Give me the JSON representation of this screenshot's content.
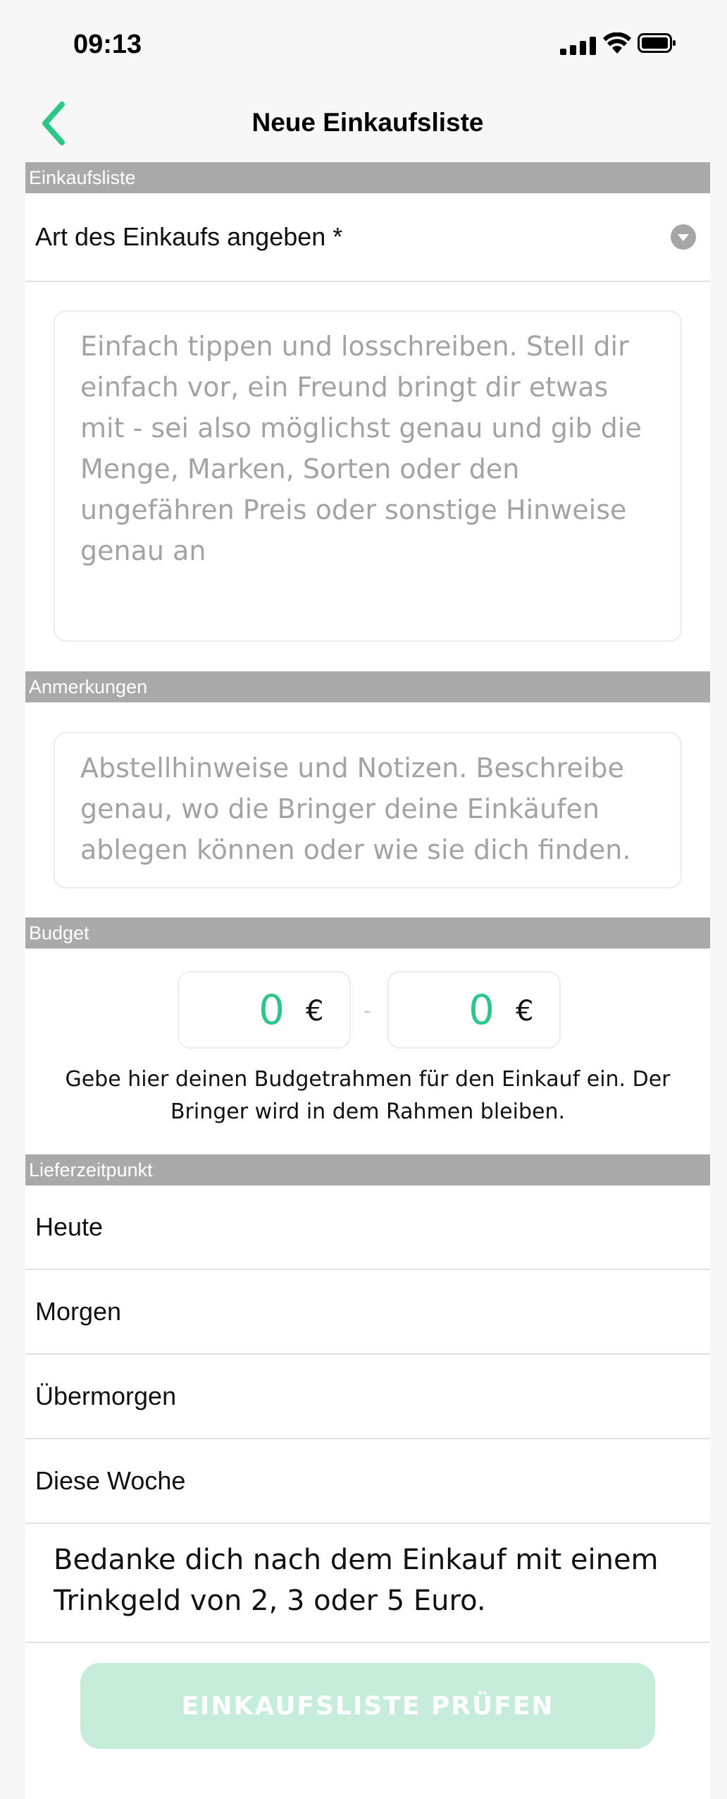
{
  "status_bar": {
    "time": "09:13"
  },
  "nav": {
    "title": "Neue Einkaufsliste",
    "back_icon": "chevron-left-icon"
  },
  "colors": {
    "accent": "#2bc789",
    "section_header": "#a9a9a9",
    "button_disabled": "#c5edd9"
  },
  "sections": {
    "einkaufsliste": "Einkaufsliste",
    "anmerkungen": "Anmerkungen",
    "budget": "Budget",
    "lieferzeitpunkt": "Lieferzeitpunkt"
  },
  "shopping_type": {
    "label": "Art des Einkaufs angeben *",
    "icon": "chevron-down-circle-icon"
  },
  "list_field": {
    "placeholder": "Einfach tippen und losschreiben. Stell dir einfach vor, ein Freund bringt dir etwas mit - sei also möglichst genau und gib die Menge, Marken, Sorten oder den ungefähren Preis oder sonstige Hinweise genau an"
  },
  "notes_field": {
    "placeholder": "Abstellhinweise und Notizen. Beschreibe genau, wo die Bringer deine Einkäufen ablegen können oder wie sie dich finden."
  },
  "budget": {
    "min": "0",
    "max": "0",
    "currency": "€",
    "separator": "-",
    "hint": "Gebe hier deinen Budgetrahmen für den Einkauf ein. Der Bringer wird in dem Rahmen bleiben."
  },
  "delivery": {
    "options": [
      {
        "label": "Heute"
      },
      {
        "label": "Morgen"
      },
      {
        "label": "Übermorgen"
      },
      {
        "label": "Diese Woche"
      }
    ]
  },
  "tip_text": "Bedanke dich nach dem Einkauf mit einem Trinkgeld von 2, 3 oder 5 Euro.",
  "submit_button": {
    "label": "EINKAUFSLISTE PRÜFEN"
  }
}
